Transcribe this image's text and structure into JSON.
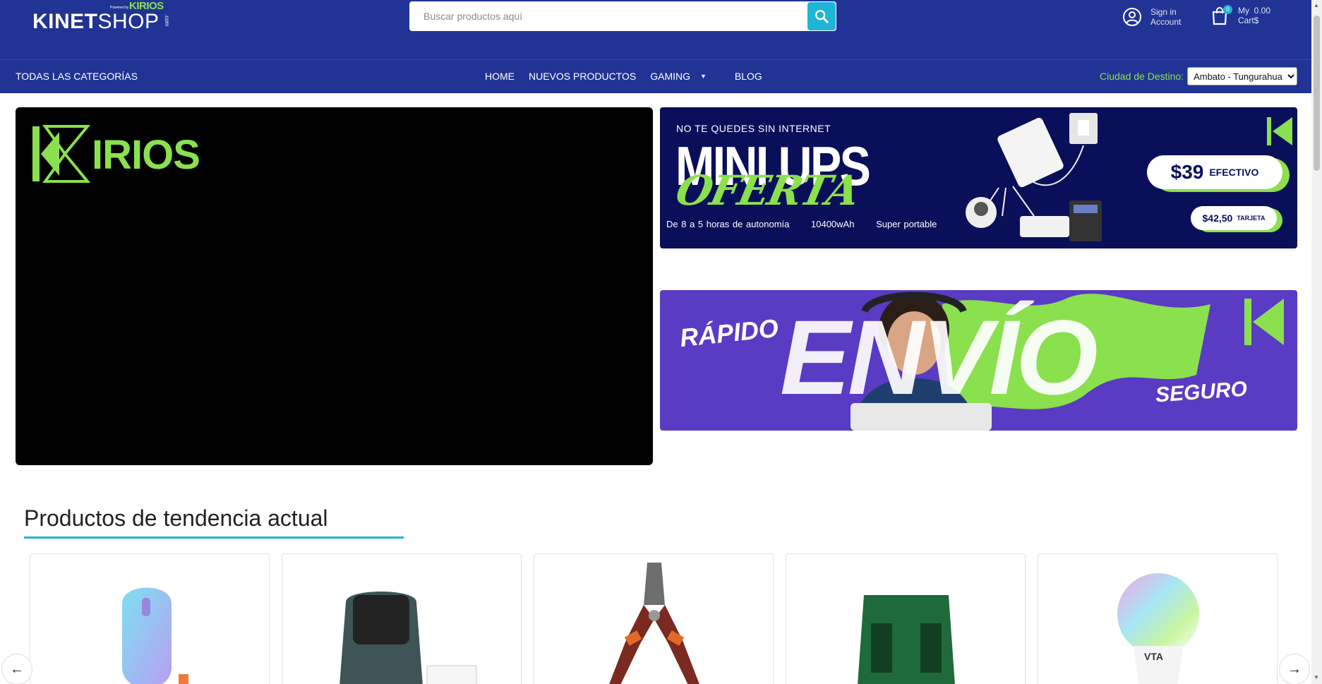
{
  "header": {
    "logo": {
      "powered_by": "Powered by",
      "brand_small": "KIRIOS",
      "wordmark_a": "KINET",
      "wordmark_b": "SHOP",
      "domain": ".com"
    },
    "search": {
      "placeholder": "Buscar productos aquí"
    },
    "account": {
      "line1": "Sign in",
      "line2": "Account"
    },
    "cart": {
      "count": "0",
      "line1": "My  0.00",
      "line2": "Cart$"
    }
  },
  "nav": {
    "categories": "TODAS LAS CATEGORÍAS",
    "links": [
      "HOME",
      "NUEVOS PRODUCTOS",
      "GAMING",
      "BLOG"
    ],
    "destino_label": "Ciudad de Destino:",
    "destino_value": "Ambato - Tungurahua"
  },
  "hero": {
    "brand": "IRIOS"
  },
  "banner1": {
    "top": "NO TE QUEDES SIN INTERNET",
    "title": "MINI UPS",
    "oferta": "OFERTA",
    "sub": [
      "De 8 a 5 horas de autonomía",
      "10400wAh",
      "Super portable"
    ],
    "price1": "$39",
    "price1_label": "EFECTIVO",
    "price2": "$42,50",
    "price2_label": "TARJETA"
  },
  "banner2": {
    "left": "RÁPIDO",
    "center": "ENVÍO",
    "right": "SEGURO"
  },
  "trending": {
    "title": "Productos de tendencia actual",
    "products": [
      "mouse",
      "printer",
      "pliers",
      "tool-block",
      "smart-bulb"
    ]
  },
  "colors": {
    "primary": "#213394",
    "accent": "#1fb5d8",
    "green": "#8be04e"
  }
}
